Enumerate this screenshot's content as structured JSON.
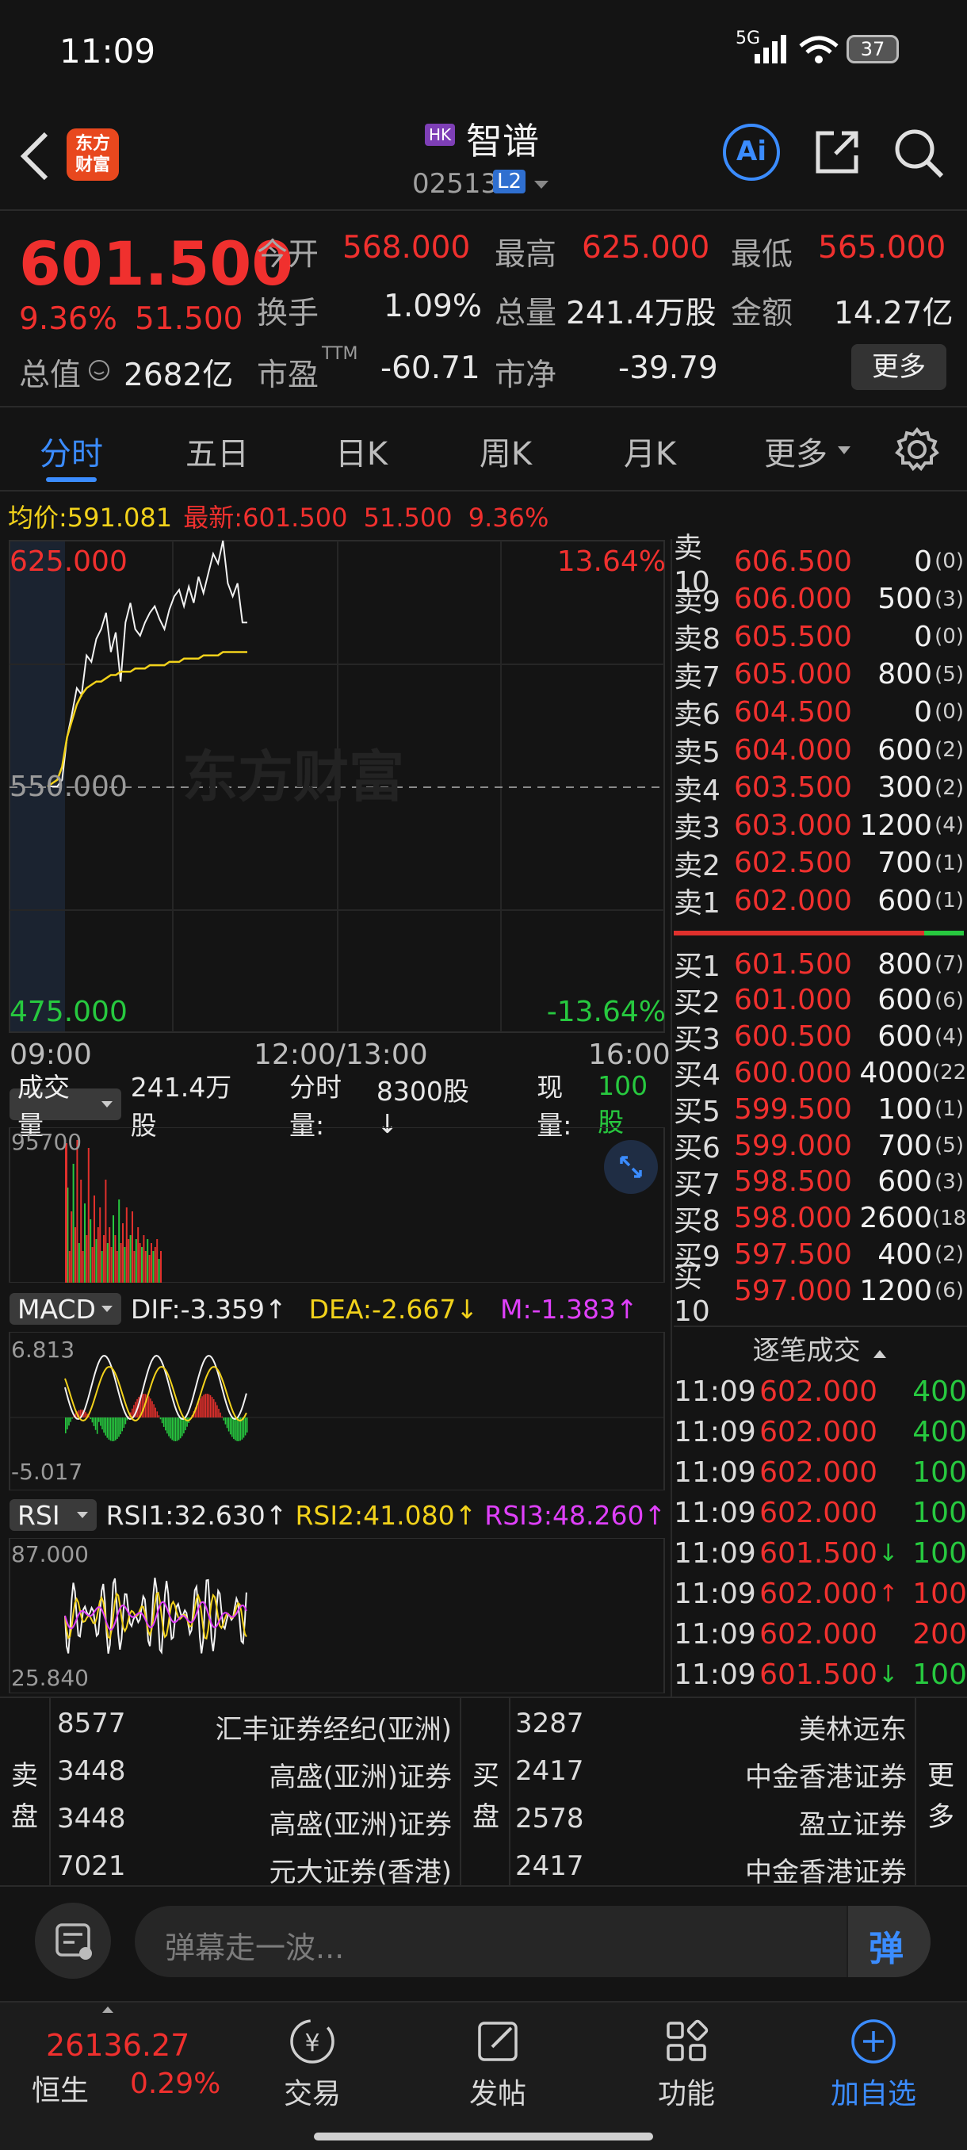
{
  "status": {
    "time": "11:09",
    "network": "5G",
    "battery": "37"
  },
  "header": {
    "logo_line1": "东方",
    "logo_line2": "财富",
    "market_badge": "HK",
    "name": "智谱",
    "code": "02513",
    "level_badge": "L2",
    "ai_label": "Ai"
  },
  "quote": {
    "price": "601.500",
    "change_pct": "9.36%",
    "change": "51.500",
    "open_label": "今开",
    "open": "568.000",
    "high_label": "最高",
    "high": "625.000",
    "low_label": "最低",
    "low": "565.000",
    "turnover_label": "换手",
    "turnover": "1.09%",
    "volume_label": "总量",
    "volume": "241.4万股",
    "amount_label": "金额",
    "amount": "14.27亿",
    "mktcap_label": "总值",
    "mktcap": "2682亿",
    "pe_label": "市盈",
    "pe_sup": "TTM",
    "pe": "-60.71",
    "pb_label": "市净",
    "pb": "-39.79",
    "more_button": "更多"
  },
  "tabs": [
    "分时",
    "五日",
    "日K",
    "周K",
    "月K",
    "更多"
  ],
  "chart_info": {
    "avg_label": "均价:",
    "avg": "591.081",
    "latest_label": "最新:",
    "latest": "601.500",
    "change": "51.500",
    "change_pct": "9.36%"
  },
  "chart_data": {
    "type": "line",
    "title": "",
    "xlabel": "",
    "ylabel": "",
    "x_ticks": [
      "09:00",
      "12:00/13:00",
      "16:00"
    ],
    "ylim": [
      475.0,
      625.0
    ],
    "y_labels": {
      "top": "625.000",
      "mid": "550.000",
      "bottom": "475.000"
    },
    "pct_labels": {
      "top": "13.64%",
      "bottom": "-13.64%"
    },
    "series": [
      {
        "values": [
          550,
          550,
          550,
          552,
          565,
          572,
          580,
          578,
          590,
          588,
          595,
          598,
          603,
          591,
          597,
          582,
          600,
          606,
          598,
          596,
          600,
          603,
          605,
          601,
          598,
          604,
          608,
          610,
          605,
          611,
          606,
          614,
          609,
          615,
          621,
          618,
          625,
          612,
          608,
          612,
          600,
          600
        ]
      },
      {
        "values": [
          550,
          551,
          552,
          556,
          565,
          570,
          575,
          578,
          580,
          581,
          582,
          582,
          583,
          584,
          584,
          585,
          585,
          585,
          586,
          586,
          586,
          587,
          587,
          587,
          587,
          588,
          588,
          588,
          589,
          589,
          589,
          589,
          590,
          590,
          590,
          590,
          591,
          591,
          591,
          591,
          591,
          591
        ]
      }
    ]
  },
  "watermark": "东方财富",
  "order_book": {
    "asks": [
      {
        "label": "卖10",
        "price": "606.500",
        "qty": "0",
        "count": "(0)"
      },
      {
        "label": "卖9",
        "price": "606.000",
        "qty": "500",
        "count": "(3)"
      },
      {
        "label": "卖8",
        "price": "605.500",
        "qty": "0",
        "count": "(0)"
      },
      {
        "label": "卖7",
        "price": "605.000",
        "qty": "800",
        "count": "(5)"
      },
      {
        "label": "卖6",
        "price": "604.500",
        "qty": "0",
        "count": "(0)"
      },
      {
        "label": "卖5",
        "price": "604.000",
        "qty": "600",
        "count": "(2)"
      },
      {
        "label": "卖4",
        "price": "603.500",
        "qty": "300",
        "count": "(2)"
      },
      {
        "label": "卖3",
        "price": "603.000",
        "qty": "1200",
        "count": "(4)"
      },
      {
        "label": "卖2",
        "price": "602.500",
        "qty": "700",
        "count": "(1)"
      },
      {
        "label": "卖1",
        "price": "602.000",
        "qty": "600",
        "count": "(1)"
      }
    ],
    "bids": [
      {
        "label": "买1",
        "price": "601.500",
        "qty": "800",
        "count": "(7)"
      },
      {
        "label": "买2",
        "price": "601.000",
        "qty": "600",
        "count": "(6)"
      },
      {
        "label": "买3",
        "price": "600.500",
        "qty": "600",
        "count": "(4)"
      },
      {
        "label": "买4",
        "price": "600.000",
        "qty": "4000",
        "count": "(22)"
      },
      {
        "label": "买5",
        "price": "599.500",
        "qty": "100",
        "count": "(1)"
      },
      {
        "label": "买6",
        "price": "599.000",
        "qty": "700",
        "count": "(5)"
      },
      {
        "label": "买7",
        "price": "598.500",
        "qty": "600",
        "count": "(3)"
      },
      {
        "label": "买8",
        "price": "598.000",
        "qty": "2600",
        "count": "(18)"
      },
      {
        "label": "买9",
        "price": "597.500",
        "qty": "400",
        "count": "(2)"
      },
      {
        "label": "买10",
        "price": "597.000",
        "qty": "1200",
        "count": "(6)"
      }
    ]
  },
  "ticks": {
    "title": "逐笔成交",
    "rows": [
      {
        "time": "11:09",
        "price": "602.000",
        "arrow": "",
        "vol": "400",
        "dir": "buy"
      },
      {
        "time": "11:09",
        "price": "602.000",
        "arrow": "",
        "vol": "400",
        "dir": "buy"
      },
      {
        "time": "11:09",
        "price": "602.000",
        "arrow": "",
        "vol": "100",
        "dir": "buy"
      },
      {
        "time": "11:09",
        "price": "602.000",
        "arrow": "",
        "vol": "100",
        "dir": "buy"
      },
      {
        "time": "11:09",
        "price": "601.500",
        "arrow": "↓",
        "vol": "100",
        "dir": "buy"
      },
      {
        "time": "11:09",
        "price": "602.000",
        "arrow": "↑",
        "vol": "100",
        "dir": "sell"
      },
      {
        "time": "11:09",
        "price": "602.000",
        "arrow": "",
        "vol": "200",
        "dir": "sell"
      },
      {
        "time": "11:09",
        "price": "601.500",
        "arrow": "↓",
        "vol": "100",
        "dir": "buy"
      }
    ]
  },
  "volume_bar": {
    "label": "成交量",
    "total": "241.4万股",
    "minute_label": "分时量:",
    "minute": "8300股↓",
    "now_label": "现量:",
    "now": "100股",
    "max": "95700"
  },
  "macd": {
    "label": "MACD",
    "dif": "DIF:-3.359↑",
    "dea": "DEA:-2.667↓",
    "m": "M:-1.383↑",
    "max": "6.813",
    "min": "-5.017"
  },
  "rsi": {
    "label": "RSI",
    "rsi1": "RSI1:32.630↑",
    "rsi2": "RSI2:41.080↑",
    "rsi3": "RSI3:48.260↑",
    "max": "87.000",
    "min": "25.840"
  },
  "brokers": {
    "sell_label": [
      "卖",
      "盘"
    ],
    "buy_label": [
      "买",
      "盘"
    ],
    "more": [
      "更",
      "多"
    ],
    "sell": [
      {
        "code": "8577",
        "name": "汇丰证券经纪(亚洲)"
      },
      {
        "code": "3448",
        "name": "高盛(亚洲)证券"
      },
      {
        "code": "3448",
        "name": "高盛(亚洲)证券"
      },
      {
        "code": "7021",
        "name": "元大证券(香港)"
      }
    ],
    "buy": [
      {
        "code": "3287",
        "name": "美林远东"
      },
      {
        "code": "2417",
        "name": "中金香港证券"
      },
      {
        "code": "2578",
        "name": "盈立证券"
      },
      {
        "code": "2417",
        "name": "中金香港证券"
      }
    ]
  },
  "comment": {
    "placeholder": "弹幕走一波...",
    "danmu": "弹"
  },
  "bottom_nav": {
    "index_value": "26136.27",
    "index_name": "恒生",
    "index_pct": "0.29%",
    "items": [
      "交易",
      "发帖",
      "功能",
      "加自选"
    ]
  },
  "colors": {
    "up": "#f0302e",
    "down": "#27c93f",
    "avg": "#f2d21b",
    "accent": "#3b8cff"
  }
}
